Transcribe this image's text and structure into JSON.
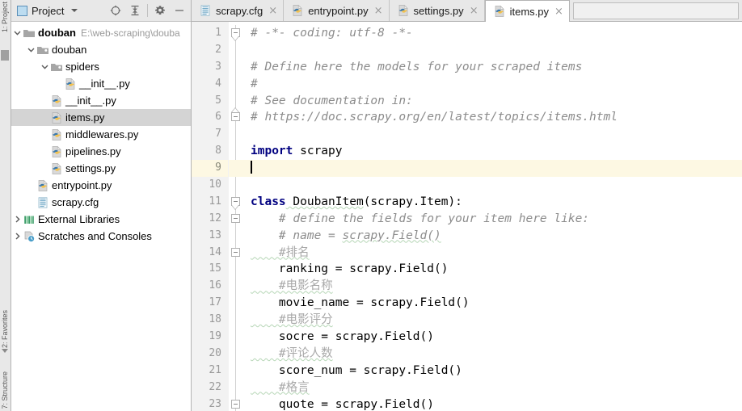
{
  "left_strip": {
    "labels": [
      {
        "name": "project-tool-label",
        "text": "1: Project"
      },
      {
        "name": "favorites-tool-label",
        "text": "2: Favorites"
      },
      {
        "name": "structure-tool-label",
        "text": "7: Structure"
      }
    ]
  },
  "project_panel": {
    "toolbar": {
      "title": "Project",
      "window_icon": "window-icon",
      "dropdown_icon": "chevron-down-icon",
      "buttons": [
        {
          "name": "locate-button",
          "icon": "target-icon",
          "tooltip": "Select Opened File"
        },
        {
          "name": "collapse-all-button",
          "icon": "collapse-all-icon",
          "tooltip": "Collapse All"
        },
        {
          "name": "settings-button",
          "icon": "gear-icon",
          "tooltip": "Settings"
        },
        {
          "name": "hide-button",
          "icon": "minimize-icon",
          "tooltip": "Hide"
        }
      ]
    },
    "tree": [
      {
        "label": "douban",
        "path": "E:\\web-scraping\\douba",
        "icon": "folder-icon",
        "depth": 0,
        "twisty": "expanded",
        "bold": true,
        "selected": false
      },
      {
        "label": "douban",
        "path": "",
        "icon": "module-folder-icon",
        "depth": 1,
        "twisty": "expanded",
        "bold": false,
        "selected": false
      },
      {
        "label": "spiders",
        "path": "",
        "icon": "module-folder-icon",
        "depth": 2,
        "twisty": "expanded",
        "bold": false,
        "selected": false
      },
      {
        "label": "__init__.py",
        "path": "",
        "icon": "python-file-icon",
        "depth": 3,
        "twisty": "none",
        "bold": false,
        "selected": false
      },
      {
        "label": "__init__.py",
        "path": "",
        "icon": "python-file-icon",
        "depth": 2,
        "twisty": "none",
        "bold": false,
        "selected": false
      },
      {
        "label": "items.py",
        "path": "",
        "icon": "python-file-icon",
        "depth": 2,
        "twisty": "none",
        "bold": false,
        "selected": true
      },
      {
        "label": "middlewares.py",
        "path": "",
        "icon": "python-file-icon",
        "depth": 2,
        "twisty": "none",
        "bold": false,
        "selected": false
      },
      {
        "label": "pipelines.py",
        "path": "",
        "icon": "python-file-icon",
        "depth": 2,
        "twisty": "none",
        "bold": false,
        "selected": false
      },
      {
        "label": "settings.py",
        "path": "",
        "icon": "python-file-icon",
        "depth": 2,
        "twisty": "none",
        "bold": false,
        "selected": false
      },
      {
        "label": "entrypoint.py",
        "path": "",
        "icon": "python-file-icon",
        "depth": 1,
        "twisty": "none",
        "bold": false,
        "selected": false
      },
      {
        "label": "scrapy.cfg",
        "path": "",
        "icon": "config-file-icon",
        "depth": 1,
        "twisty": "none",
        "bold": false,
        "selected": false
      },
      {
        "label": "External Libraries",
        "path": "",
        "icon": "libraries-icon",
        "depth": 0,
        "twisty": "collapsed",
        "bold": false,
        "selected": false
      },
      {
        "label": "Scratches and Consoles",
        "path": "",
        "icon": "scratches-icon",
        "depth": 0,
        "twisty": "collapsed",
        "bold": false,
        "selected": false
      }
    ]
  },
  "editor": {
    "tabs": [
      {
        "label": "scrapy.cfg",
        "icon": "config-file-icon",
        "active": false,
        "close": "×"
      },
      {
        "label": "entrypoint.py",
        "icon": "python-file-icon",
        "active": false,
        "close": "×"
      },
      {
        "label": "settings.py",
        "icon": "python-file-icon",
        "active": false,
        "close": "×"
      },
      {
        "label": "items.py",
        "icon": "python-file-icon",
        "active": true,
        "close": "×"
      }
    ],
    "current_line": 9,
    "lines": [
      {
        "n": 1,
        "fold": "start-down",
        "tokens": [
          {
            "t": "# -*- coding: utf-8 -*-",
            "c": "com"
          }
        ]
      },
      {
        "n": 2,
        "fold": "",
        "tokens": []
      },
      {
        "n": 3,
        "fold": "",
        "tokens": [
          {
            "t": "# Define here the models for your scraped items",
            "c": "com"
          }
        ]
      },
      {
        "n": 4,
        "fold": "",
        "tokens": [
          {
            "t": "#",
            "c": "com"
          }
        ]
      },
      {
        "n": 5,
        "fold": "",
        "tokens": [
          {
            "t": "# See documentation in:",
            "c": "com"
          }
        ]
      },
      {
        "n": 6,
        "fold": "end-up",
        "tokens": [
          {
            "t": "# https://doc.scrapy.org/en/latest/topics/items.html",
            "c": "com"
          }
        ]
      },
      {
        "n": 7,
        "fold": "",
        "tokens": []
      },
      {
        "n": 8,
        "fold": "",
        "tokens": [
          {
            "t": "import",
            "c": "kw"
          },
          {
            "t": " scrapy",
            "c": "txt"
          }
        ]
      },
      {
        "n": 9,
        "fold": "",
        "tokens": [],
        "caret": true
      },
      {
        "n": 10,
        "fold": "",
        "tokens": []
      },
      {
        "n": 11,
        "fold": "start-down",
        "tokens": [
          {
            "t": "class",
            "c": "kw"
          },
          {
            "t": " DoubanItem",
            "c": "txt",
            "sq": true
          },
          {
            "t": "(scrapy.Item):",
            "c": "txt"
          }
        ]
      },
      {
        "n": 12,
        "fold": "box",
        "tokens": [
          {
            "t": "    # define the fields for your item here like:",
            "c": "com"
          }
        ]
      },
      {
        "n": 13,
        "fold": "",
        "tokens": [
          {
            "t": "    # name = ",
            "c": "com"
          },
          {
            "t": "scrapy.Field()",
            "c": "com",
            "sq": true
          }
        ]
      },
      {
        "n": 14,
        "fold": "box",
        "tokens": [
          {
            "t": "    #排名",
            "c": "com-cn",
            "sq": true
          }
        ]
      },
      {
        "n": 15,
        "fold": "",
        "tokens": [
          {
            "t": "    ranking = scrapy.Field()",
            "c": "txt"
          }
        ]
      },
      {
        "n": 16,
        "fold": "",
        "tokens": [
          {
            "t": "    #电影名称",
            "c": "com-cn",
            "sq": true
          }
        ]
      },
      {
        "n": 17,
        "fold": "",
        "tokens": [
          {
            "t": "    movie_name = scrapy.Field()",
            "c": "txt"
          }
        ]
      },
      {
        "n": 18,
        "fold": "",
        "tokens": [
          {
            "t": "    #电影评分",
            "c": "com-cn",
            "sq": true
          }
        ]
      },
      {
        "n": 19,
        "fold": "",
        "tokens": [
          {
            "t": "    socre = scrapy.Field()",
            "c": "txt"
          }
        ]
      },
      {
        "n": 20,
        "fold": "",
        "tokens": [
          {
            "t": "    #评论人数",
            "c": "com-cn",
            "sq": true
          }
        ]
      },
      {
        "n": 21,
        "fold": "",
        "tokens": [
          {
            "t": "    score_num = scrapy.Field()",
            "c": "txt"
          }
        ]
      },
      {
        "n": 22,
        "fold": "",
        "tokens": [
          {
            "t": "    #格言",
            "c": "com-cn",
            "sq": true
          }
        ]
      },
      {
        "n": 23,
        "fold": "box",
        "tokens": [
          {
            "t": "    quote = scrapy.Field()",
            "c": "txt"
          }
        ]
      }
    ]
  },
  "colors": {
    "keyword": "#000080",
    "comment": "#8c8c8c",
    "current_line_bg": "#fdf8e3",
    "selection_bg": "#d4d4d4",
    "chrome_bg": "#e8e8e8",
    "gutter_bg": "#f2f2f2"
  }
}
